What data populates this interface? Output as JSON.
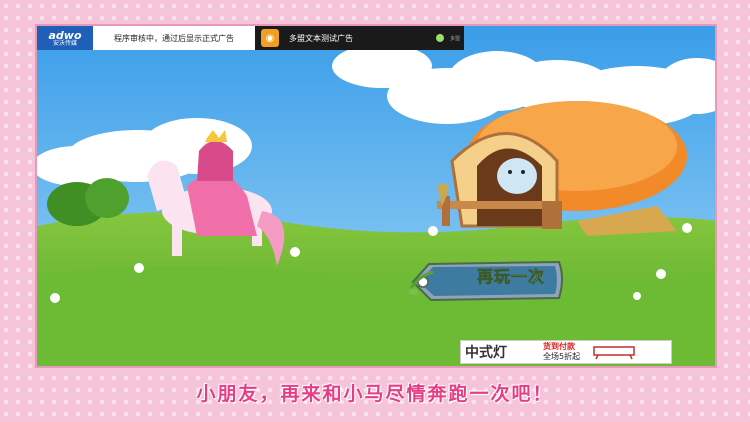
{
  "top_ad": {
    "brand": "adwo",
    "brand_sub": "安沃传媒",
    "review_text": "程序审核中，通过后显示正式广告",
    "test_text": "多盟文本测试广告",
    "tiny_label": "多盟"
  },
  "replay_button": {
    "label": "再玩一次"
  },
  "bottom_ad": {
    "title": "中式灯",
    "promo_line1": "货到付款",
    "promo_line2": "全场5折起"
  },
  "caption": "小朋友，再来和小马尽情奔跑一次吧！",
  "colors": {
    "frame_pink": "#f6c4d8",
    "caption_pink": "#e63d86",
    "sky_blue": "#5fb3ee",
    "grass_green": "#6ab53a",
    "roof_orange": "#f38a2a"
  }
}
